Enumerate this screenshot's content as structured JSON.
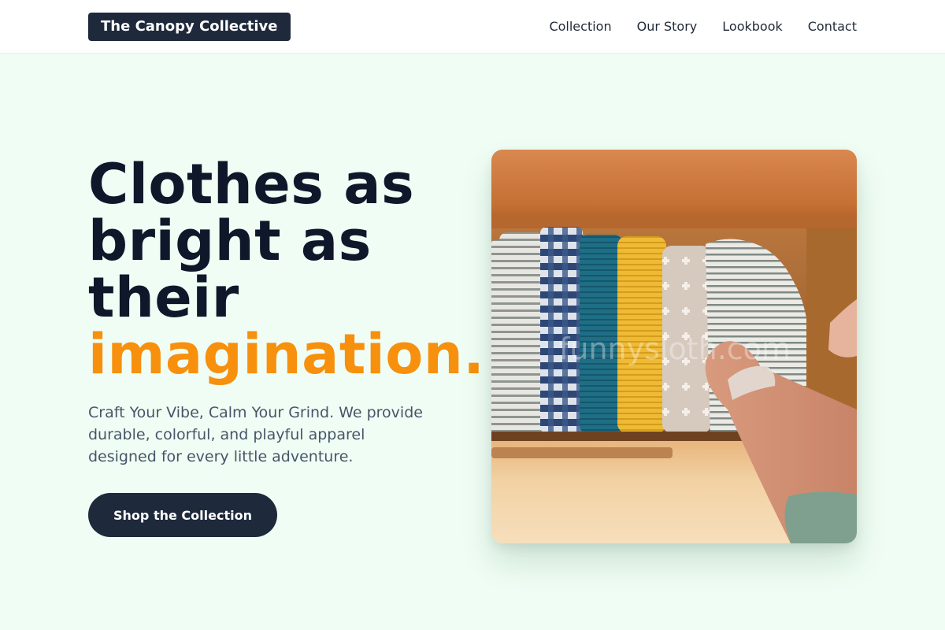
{
  "header": {
    "logo": "The Canopy Collective",
    "nav": [
      "Collection",
      "Our Story",
      "Lookbook",
      "Contact"
    ]
  },
  "hero": {
    "headline_lines": [
      "Clothes as",
      "bright as",
      "their"
    ],
    "headline_accent": "imagination.",
    "subtitle_lines": [
      "Craft Your Vibe, Calm Your Grind. We provide",
      "durable, colorful, and playful apparel",
      "designed for every little adventure."
    ],
    "cta_label": "Shop the Collection",
    "image_alt": "Folded colorful muslin cloths in a wooden drawer",
    "watermark": "funnysloth.com"
  },
  "colors": {
    "background": "#f0fdf4",
    "header_bg": "#ffffff",
    "dark": "#1e293b",
    "headline": "#0f172a",
    "accent": "#f7900d",
    "body_text": "#475569"
  }
}
